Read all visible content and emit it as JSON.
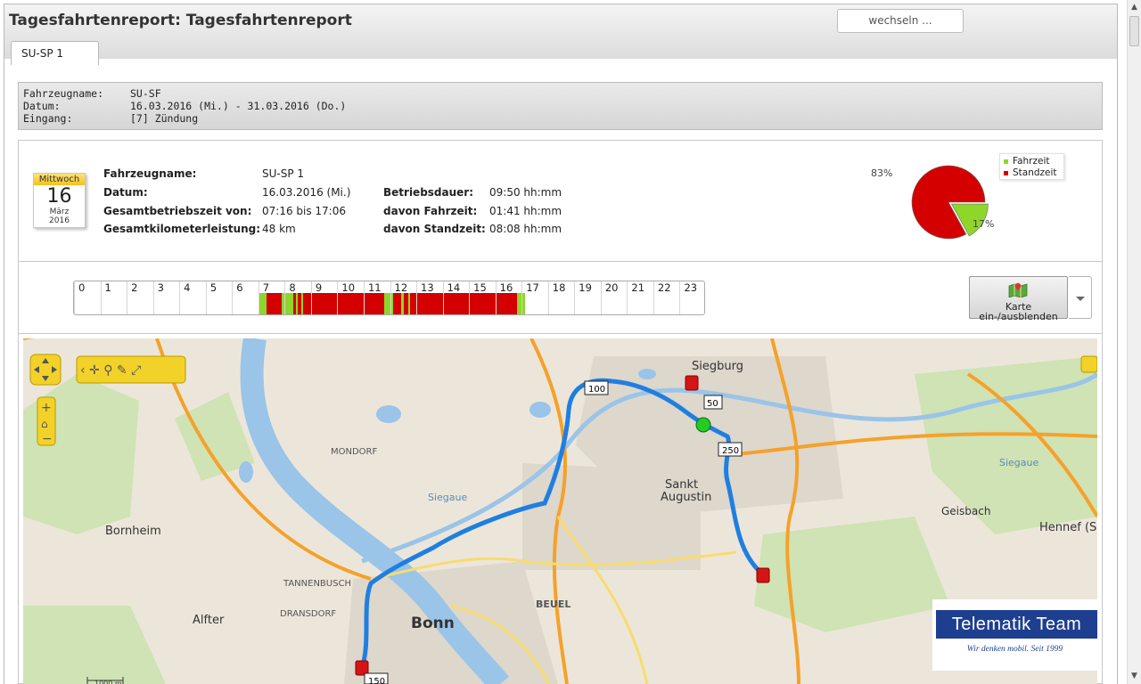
{
  "header": {
    "title": "Tagesfahrtenreport: Tagesfahrtenreport",
    "switch_label": "wechseln ...",
    "tab_label": "SU-SP 1"
  },
  "infobox": {
    "rows": [
      {
        "key": "Fahrzeugname:",
        "value": "SU-SF"
      },
      {
        "key": "Datum:",
        "value": "16.03.2016 (Mi.) - 31.03.2016 (Do.)"
      },
      {
        "key": "Eingang:",
        "value": "[7] Zündung"
      }
    ]
  },
  "calendar": {
    "weekday": "Mittwoch",
    "day": "16",
    "month": "März",
    "year": "2016"
  },
  "stats": {
    "vehicle_label": "Fahrzeugname:",
    "vehicle_value": "SU-SP 1",
    "date_label": "Datum:",
    "date_value": "16.03.2016 (Mi.)",
    "op_from_label": "Gesamtbetriebszeit von:",
    "op_from_value": "07:16 bis 17:06",
    "km_label": "Gesamtkilometerleistung:",
    "km_value": "48 km",
    "duration_label": "Betriebsdauer:",
    "duration_value": "09:50 hh:mm",
    "drive_label": "davon Fahrzeit:",
    "drive_value": "01:41 hh:mm",
    "stand_label": "davon Standzeit:",
    "stand_value": "08:08 hh:mm"
  },
  "chart_data": {
    "type": "pie",
    "slices": [
      {
        "name": "Fahrzeit",
        "value": 17,
        "label": "17%",
        "color": "#8fd62a"
      },
      {
        "name": "Standzeit",
        "value": 83,
        "label": "83%",
        "color": "#d40000"
      }
    ]
  },
  "timeline": {
    "hours": [
      "0",
      "1",
      "2",
      "3",
      "4",
      "5",
      "6",
      "7",
      "8",
      "9",
      "10",
      "11",
      "12",
      "13",
      "14",
      "15",
      "16",
      "17",
      "18",
      "19",
      "20",
      "21",
      "22",
      "23"
    ],
    "segments": [
      {
        "start": 7.0,
        "end": 7.27,
        "color": "#8fd62a"
      },
      {
        "start": 7.27,
        "end": 7.85,
        "color": "#d40000"
      },
      {
        "start": 7.85,
        "end": 8.3,
        "color": "#8fd62a"
      },
      {
        "start": 8.3,
        "end": 8.4,
        "color": "#d40000"
      },
      {
        "start": 8.4,
        "end": 8.45,
        "color": "#8fd62a"
      },
      {
        "start": 8.45,
        "end": 8.6,
        "color": "#d40000"
      },
      {
        "start": 8.6,
        "end": 8.65,
        "color": "#8fd62a"
      },
      {
        "start": 8.65,
        "end": 11.75,
        "color": "#d40000"
      },
      {
        "start": 11.75,
        "end": 12.1,
        "color": "#8fd62a"
      },
      {
        "start": 12.1,
        "end": 12.4,
        "color": "#d40000"
      },
      {
        "start": 12.4,
        "end": 12.5,
        "color": "#8fd62a"
      },
      {
        "start": 12.5,
        "end": 12.65,
        "color": "#d40000"
      },
      {
        "start": 12.65,
        "end": 12.72,
        "color": "#8fd62a"
      },
      {
        "start": 12.72,
        "end": 16.8,
        "color": "#d40000"
      },
      {
        "start": 16.8,
        "end": 17.1,
        "color": "#8fd62a"
      }
    ]
  },
  "map_toggle": {
    "line1": "Karte",
    "line2": "ein-/ausblenden"
  },
  "map": {
    "places": [
      "Siegburg",
      "Sankt",
      "Augustin",
      "Bornheim",
      "Bonn",
      "Alfter",
      "BEUEL",
      "Hennef (Si",
      "Geisbach",
      "Siegaue",
      "MONDORF",
      "TANNENBUSCH",
      "DRANSDORF",
      "Siegaue"
    ],
    "markers": [
      "100",
      "50",
      "250",
      "150"
    ],
    "scale": "1000 m",
    "logo_text": "Telematik Team",
    "logo_slogan": "Wir denken mobil. Seit 1999"
  }
}
